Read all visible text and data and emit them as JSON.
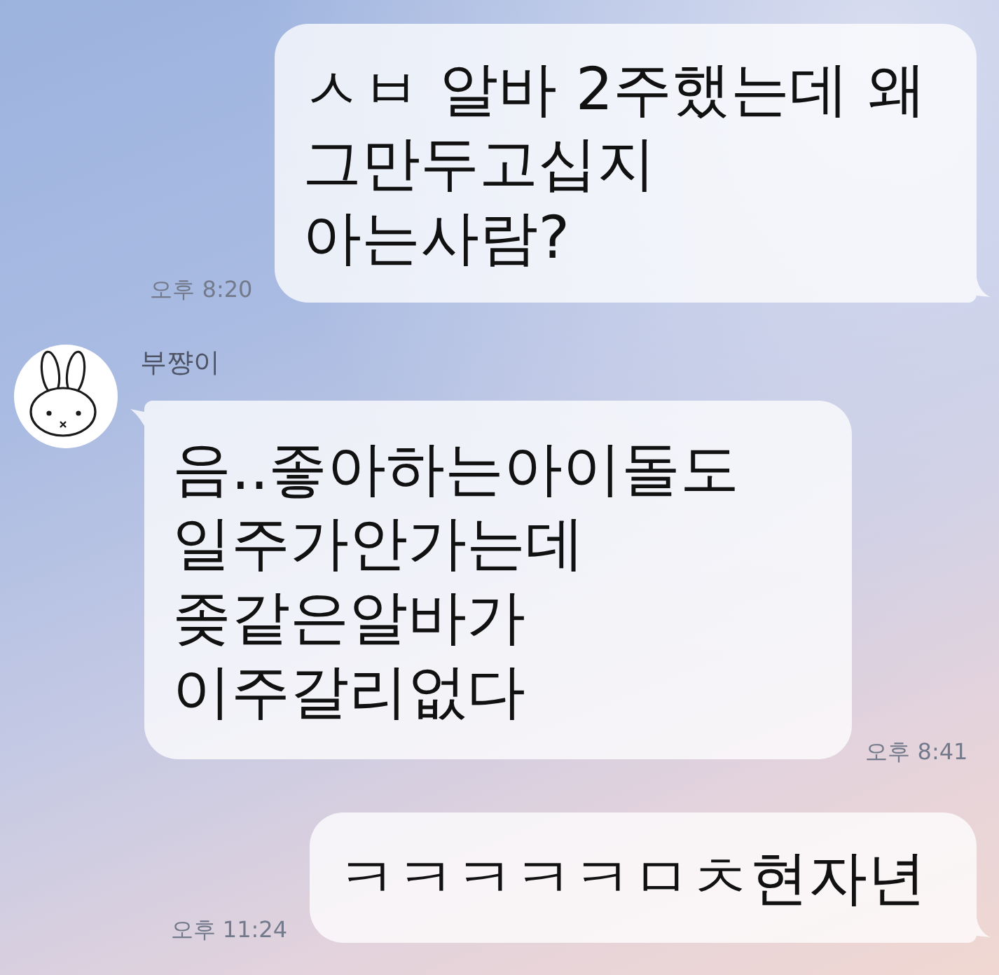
{
  "messages": [
    {
      "kind": "sent",
      "text": "ㅅㅂ 알바 2주했는데 왜\n그만두고십지\n아는사람?",
      "time": "오후 8:20"
    },
    {
      "kind": "received",
      "sender": "부쨩이",
      "text": "음..좋아하는아이돌도\n일주가안가는데\n좆같은알바가\n이주갈리없다",
      "time": "오후 8:41"
    },
    {
      "kind": "sent",
      "text": "ㅋㅋㅋㅋㅋㅁㅊ현자년",
      "time": "오후 11:24"
    }
  ]
}
